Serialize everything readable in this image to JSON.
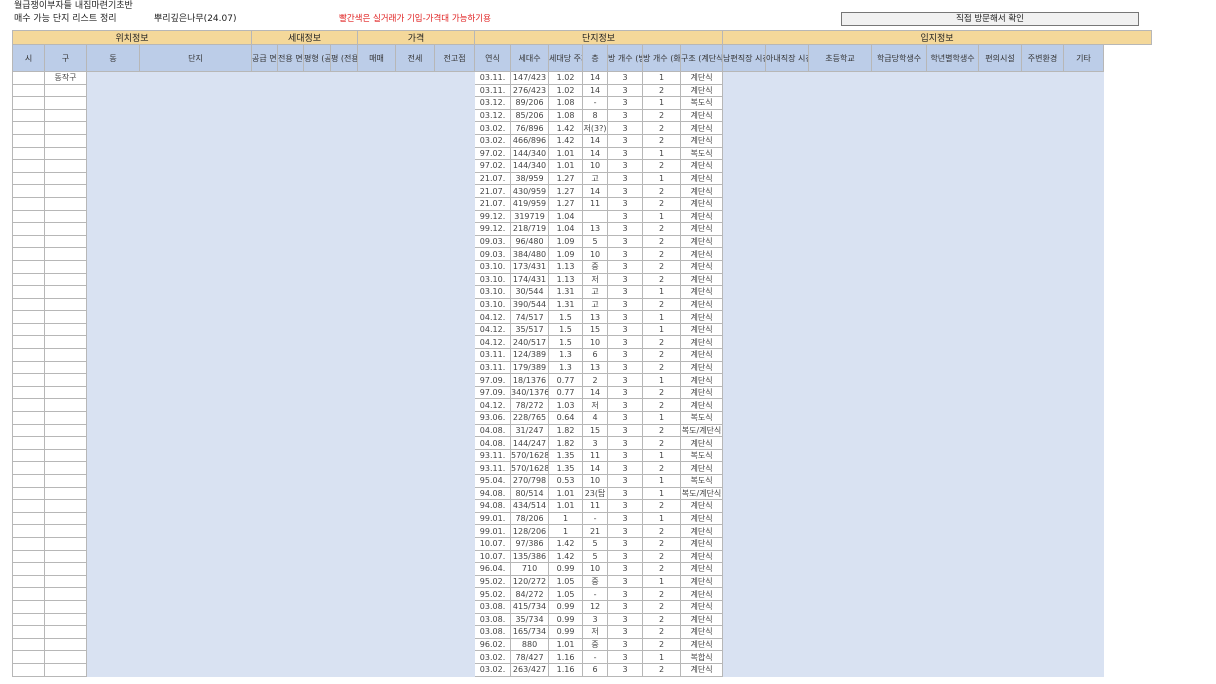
{
  "header": {
    "title": "월급쟁이부자들 내집마련기초반",
    "subtitle": "매수 가능 단지 리스트 정리",
    "author": "뿌리깊은나무(24.07)",
    "note": "빨간색은 실거래가 기입-가격대 가능하기용",
    "visit_label": "직접 방문해서 확인"
  },
  "groups": [
    {
      "label": "위치정보",
      "span": 4
    },
    {
      "label": "세대정보",
      "span": 4
    },
    {
      "label": "가격",
      "span": 3
    },
    {
      "label": "단지정보",
      "span": 7
    },
    {
      "label": "입지정보",
      "span": 9
    }
  ],
  "columns": [
    "시",
    "구",
    "동",
    "단지",
    "공급 면적",
    "전용 면적",
    "평형 (공급)",
    "평 (전용)",
    "매매",
    "전세",
    "전고점",
    "연식",
    "세대수",
    "세대당 주차",
    "층",
    "방 개수 (방)",
    "방 개수 (화장실)",
    "구조 (계단식/",
    "남편직장 시간",
    "아내직장 시간",
    "초등학교",
    "학급당학생수",
    "학년별학생수",
    "편의시설",
    "주변환경",
    "기타"
  ],
  "first_gu": "동작구",
  "rows": [
    [
      "03.11.",
      "147/423",
      "1.02",
      "14",
      "3",
      "1",
      "계단식"
    ],
    [
      "03.11.",
      "276/423",
      "1.02",
      "14",
      "3",
      "2",
      "계단식"
    ],
    [
      "03.12.",
      "89/206",
      "1.08",
      "-",
      "3",
      "1",
      "복도식"
    ],
    [
      "03.12.",
      "85/206",
      "1.08",
      "8",
      "3",
      "2",
      "계단식"
    ],
    [
      "03.02.",
      "76/896",
      "1.42",
      "저(3?)",
      "3",
      "2",
      "계단식"
    ],
    [
      "03.02.",
      "466/896",
      "1.42",
      "14",
      "3",
      "2",
      "계단식"
    ],
    [
      "97.02.",
      "144/340",
      "1.01",
      "14",
      "3",
      "1",
      "복도식"
    ],
    [
      "97.02.",
      "144/340",
      "1.01",
      "10",
      "3",
      "2",
      "계단식"
    ],
    [
      "21.07.",
      "38/959",
      "1.27",
      "고",
      "3",
      "1",
      "계단식"
    ],
    [
      "21.07.",
      "430/959",
      "1.27",
      "14",
      "3",
      "2",
      "계단식"
    ],
    [
      "21.07.",
      "419/959",
      "1.27",
      "11",
      "3",
      "2",
      "계단식"
    ],
    [
      "99.12.",
      "319719",
      "1.04",
      "",
      "3",
      "1",
      "계단식"
    ],
    [
      "99.12.",
      "218/719",
      "1.04",
      "13",
      "3",
      "2",
      "계단식"
    ],
    [
      "09.03.",
      "96/480",
      "1.09",
      "5",
      "3",
      "2",
      "계단식"
    ],
    [
      "09.03.",
      "384/480",
      "1.09",
      "10",
      "3",
      "2",
      "계단식"
    ],
    [
      "03.10.",
      "173/431",
      "1.13",
      "중",
      "3",
      "2",
      "계단식"
    ],
    [
      "03.10.",
      "174/431",
      "1.13",
      "저",
      "3",
      "2",
      "계단식"
    ],
    [
      "03.10.",
      "30/544",
      "1.31",
      "고",
      "3",
      "1",
      "계단식"
    ],
    [
      "03.10.",
      "390/544",
      "1.31",
      "고",
      "3",
      "2",
      "계단식"
    ],
    [
      "04.12.",
      "74/517",
      "1.5",
      "13",
      "3",
      "1",
      "계단식"
    ],
    [
      "04.12.",
      "35/517",
      "1.5",
      "15",
      "3",
      "1",
      "계단식"
    ],
    [
      "04.12.",
      "240/517",
      "1.5",
      "10",
      "3",
      "2",
      "계단식"
    ],
    [
      "03.11.",
      "124/389",
      "1.3",
      "6",
      "3",
      "2",
      "계단식"
    ],
    [
      "03.11.",
      "179/389",
      "1.3",
      "13",
      "3",
      "2",
      "계단식"
    ],
    [
      "97.09.",
      "18/1376",
      "0.77",
      "2",
      "3",
      "1",
      "계단식"
    ],
    [
      "97.09.",
      "340/1376",
      "0.77",
      "14",
      "3",
      "2",
      "계단식"
    ],
    [
      "04.12.",
      "78/272",
      "1.03",
      "저",
      "3",
      "2",
      "계단식"
    ],
    [
      "93.06.",
      "228/765",
      "0.64",
      "4",
      "3",
      "1",
      "복도식"
    ],
    [
      "04.08.",
      "31/247",
      "1.82",
      "15",
      "3",
      "2",
      "복도/계단식"
    ],
    [
      "04.08.",
      "144/247",
      "1.82",
      "3",
      "3",
      "2",
      "계단식"
    ],
    [
      "93.11.",
      "570/1628",
      "1.35",
      "11",
      "3",
      "1",
      "복도식"
    ],
    [
      "93.11.",
      "570/1628",
      "1.35",
      "14",
      "3",
      "2",
      "계단식"
    ],
    [
      "95.04.",
      "270/798",
      "0.53",
      "10",
      "3",
      "1",
      "복도식"
    ],
    [
      "94.08.",
      "80/514",
      "1.01",
      "23(탑",
      "3",
      "1",
      "복도/계단식"
    ],
    [
      "94.08.",
      "434/514",
      "1.01",
      "11",
      "3",
      "2",
      "계단식"
    ],
    [
      "99.01.",
      "78/206",
      "1",
      "-",
      "3",
      "1",
      "계단식"
    ],
    [
      "99.01.",
      "128/206",
      "1",
      "21",
      "3",
      "2",
      "계단식"
    ],
    [
      "10.07.",
      "97/386",
      "1.42",
      "5",
      "3",
      "2",
      "계단식"
    ],
    [
      "10.07.",
      "135/386",
      "1.42",
      "5",
      "3",
      "2",
      "계단식"
    ],
    [
      "96.04.",
      "710",
      "0.99",
      "10",
      "3",
      "2",
      "계단식"
    ],
    [
      "95.02.",
      "120/272",
      "1.05",
      "중",
      "3",
      "1",
      "계단식"
    ],
    [
      "95.02.",
      "84/272",
      "1.05",
      "-",
      "3",
      "2",
      "계단식"
    ],
    [
      "03.08.",
      "415/734",
      "0.99",
      "12",
      "3",
      "2",
      "계단식"
    ],
    [
      "03.08.",
      "35/734",
      "0.99",
      "3",
      "3",
      "2",
      "계단식"
    ],
    [
      "03.08.",
      "165/734",
      "0.99",
      "저",
      "3",
      "2",
      "계단식"
    ],
    [
      "96.02.",
      "880",
      "1.01",
      "중",
      "3",
      "2",
      "계단식"
    ],
    [
      "03.02.",
      "78/427",
      "1.16",
      "-",
      "3",
      "1",
      "복합식"
    ],
    [
      "03.02.",
      "263/427",
      "1.16",
      "6",
      "3",
      "2",
      "계단식"
    ]
  ],
  "colors": {
    "group_header": "#f4d89a",
    "column_header": "#bccde8",
    "data_fill": "#d9e2f2",
    "note_red": "#e02020"
  }
}
